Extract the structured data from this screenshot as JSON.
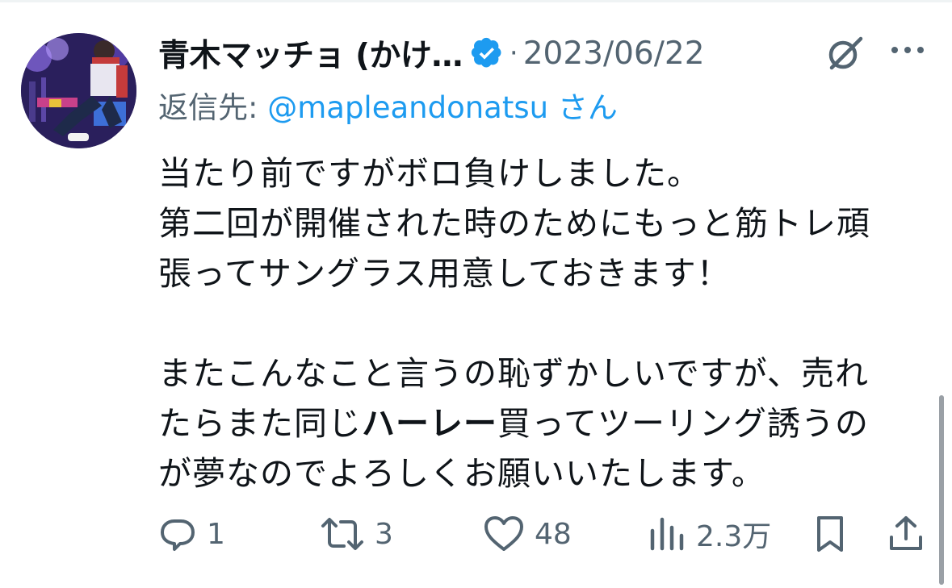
{
  "tweet": {
    "author": {
      "display_name": "青木マッチョ (かけ…",
      "verified": true,
      "avatar_alt": "avatar"
    },
    "separator": "·",
    "date": "2023/06/22",
    "reply_prefix": "返信先: ",
    "reply_handle": "@mapleandonatsu",
    "reply_suffix": " さん",
    "body": {
      "line1": "当たり前ですがボロ負けしました。",
      "line2": "第二回が開催された時のためにもっと筋トレ頑",
      "line3": "張ってサングラス用意しておきます！",
      "line4": "またこんなこと言うの恥ずかしいですが、売れ",
      "line5_pre": "たらまた同じ",
      "line5_bold": "ハーレー",
      "line5_post": "買ってツーリング誘うの",
      "line6": "が夢なのでよろしくお願いいたします。"
    }
  },
  "actions": {
    "reply_count": "1",
    "retweet_count": "3",
    "like_count": "48",
    "views_count": "2.3万"
  },
  "colors": {
    "text": "#0f1419",
    "secondary": "#536471",
    "link": "#1d9bf0",
    "verified": "#1d9bf0"
  },
  "icons": {
    "verified": "verified-badge-icon",
    "grok": "grok-icon",
    "more": "more-icon",
    "reply": "reply-icon",
    "retweet": "retweet-icon",
    "like": "heart-icon",
    "views": "views-icon",
    "bookmark": "bookmark-icon",
    "share": "share-icon"
  }
}
